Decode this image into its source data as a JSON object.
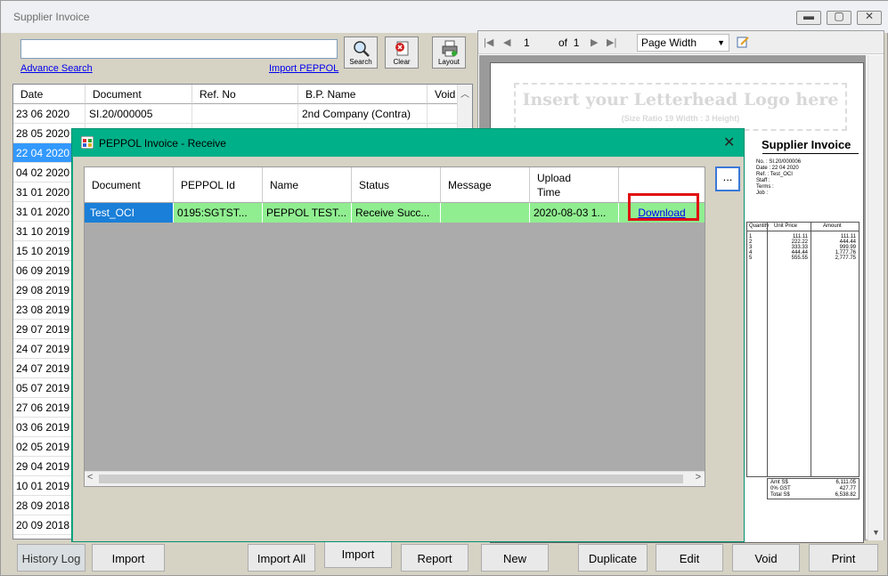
{
  "window": {
    "title": "Supplier Invoice",
    "min_glyph": "▬",
    "max_glyph": "▢",
    "close_glyph": "✕"
  },
  "search": {
    "value": "",
    "placeholder": "",
    "advance_search": "Advance Search",
    "import_peppol": "Import PEPPOL",
    "search_btn": "Search",
    "clear_btn": "Clear",
    "layout_btn": "Layout"
  },
  "grid": {
    "columns": [
      "Date",
      "Document",
      "Ref. No",
      "B.P. Name",
      "Void"
    ],
    "rows": [
      {
        "date": "23 06 2020",
        "document": "SI.20/000005",
        "ref": "",
        "bp": "2nd Company (Contra)"
      },
      {
        "date": "28 05 2020"
      },
      {
        "date": "22 04 2020",
        "selected": true
      },
      {
        "date": "04 02 2020"
      },
      {
        "date": "31 01 2020"
      },
      {
        "date": "31 01 2020"
      },
      {
        "date": "31 10 2019"
      },
      {
        "date": "15 10 2019"
      },
      {
        "date": "06 09 2019"
      },
      {
        "date": "29 08 2019"
      },
      {
        "date": "23 08 2019"
      },
      {
        "date": "29 07 2019"
      },
      {
        "date": "24 07 2019"
      },
      {
        "date": "24 07 2019"
      },
      {
        "date": "05 07 2019"
      },
      {
        "date": "27 06 2019"
      },
      {
        "date": "03 06 2019"
      },
      {
        "date": "02 05 2019"
      },
      {
        "date": "29 04 2019"
      },
      {
        "date": "10 01 2019"
      },
      {
        "date": "28 09 2018"
      },
      {
        "date": "20 09 2018"
      }
    ]
  },
  "preview": {
    "page": "1",
    "of_label": "of",
    "total_pages": "1",
    "zoom": "Page Width",
    "letterhead": "Insert your Letterhead Logo here",
    "letterhead_sub": "(Size Ratio 19 Width : 3 Height)",
    "report_title": "Supplier Invoice",
    "info_lines": [
      "No.     : SI.20/000006",
      "Date    : 22 04 2020",
      "Ref.     : Test_OCI",
      "Staff   :",
      "Terms  :",
      "Job     :"
    ],
    "items_header": [
      "Quantity",
      "Unit Price",
      "Amount"
    ],
    "items": [
      {
        "qty": "1",
        "price": "111.11",
        "amount": "111.11"
      },
      {
        "qty": "2",
        "price": "222.22",
        "amount": "444.44"
      },
      {
        "qty": "3",
        "price": "333.33",
        "amount": "999.99"
      },
      {
        "qty": "4",
        "price": "444.44",
        "amount": "1,777.76"
      },
      {
        "qty": "5",
        "price": "555.55",
        "amount": "2,777.75"
      }
    ],
    "totals": [
      {
        "label": "Amt S$",
        "value": "6,111.05"
      },
      {
        "label": "0% GST",
        "value": "427.77"
      },
      {
        "label": "Total S$",
        "value": "6,538.82"
      }
    ]
  },
  "buttons": {
    "history_log": "History Log",
    "import": "Import",
    "import_all": "Import All",
    "import2": "Import",
    "report": "Report",
    "new": "New",
    "duplicate": "Duplicate",
    "edit": "Edit",
    "void": "Void",
    "print": "Print"
  },
  "dialog": {
    "title": "PEPPOL Invoice - Receive",
    "close_glyph": "✕",
    "columns": [
      "Document",
      "PEPPOL Id",
      "Name",
      "Status",
      "Message",
      "Upload Time"
    ],
    "upload_time_line1": "Upload",
    "upload_time_line2": "Time",
    "row": {
      "document": "Test_OCI",
      "peppol_id": "0195:SGTST...",
      "name": "PEPPOL TEST...",
      "status": "Receive Succ...",
      "message": "",
      "upload_time": "2020-08-03 1...",
      "action": "Download"
    },
    "dots": "..."
  },
  "colors": {
    "dialog_border": "#00b088",
    "row_success": "#90ee90",
    "selection": "#3399ff",
    "highlight": "#e01010"
  }
}
